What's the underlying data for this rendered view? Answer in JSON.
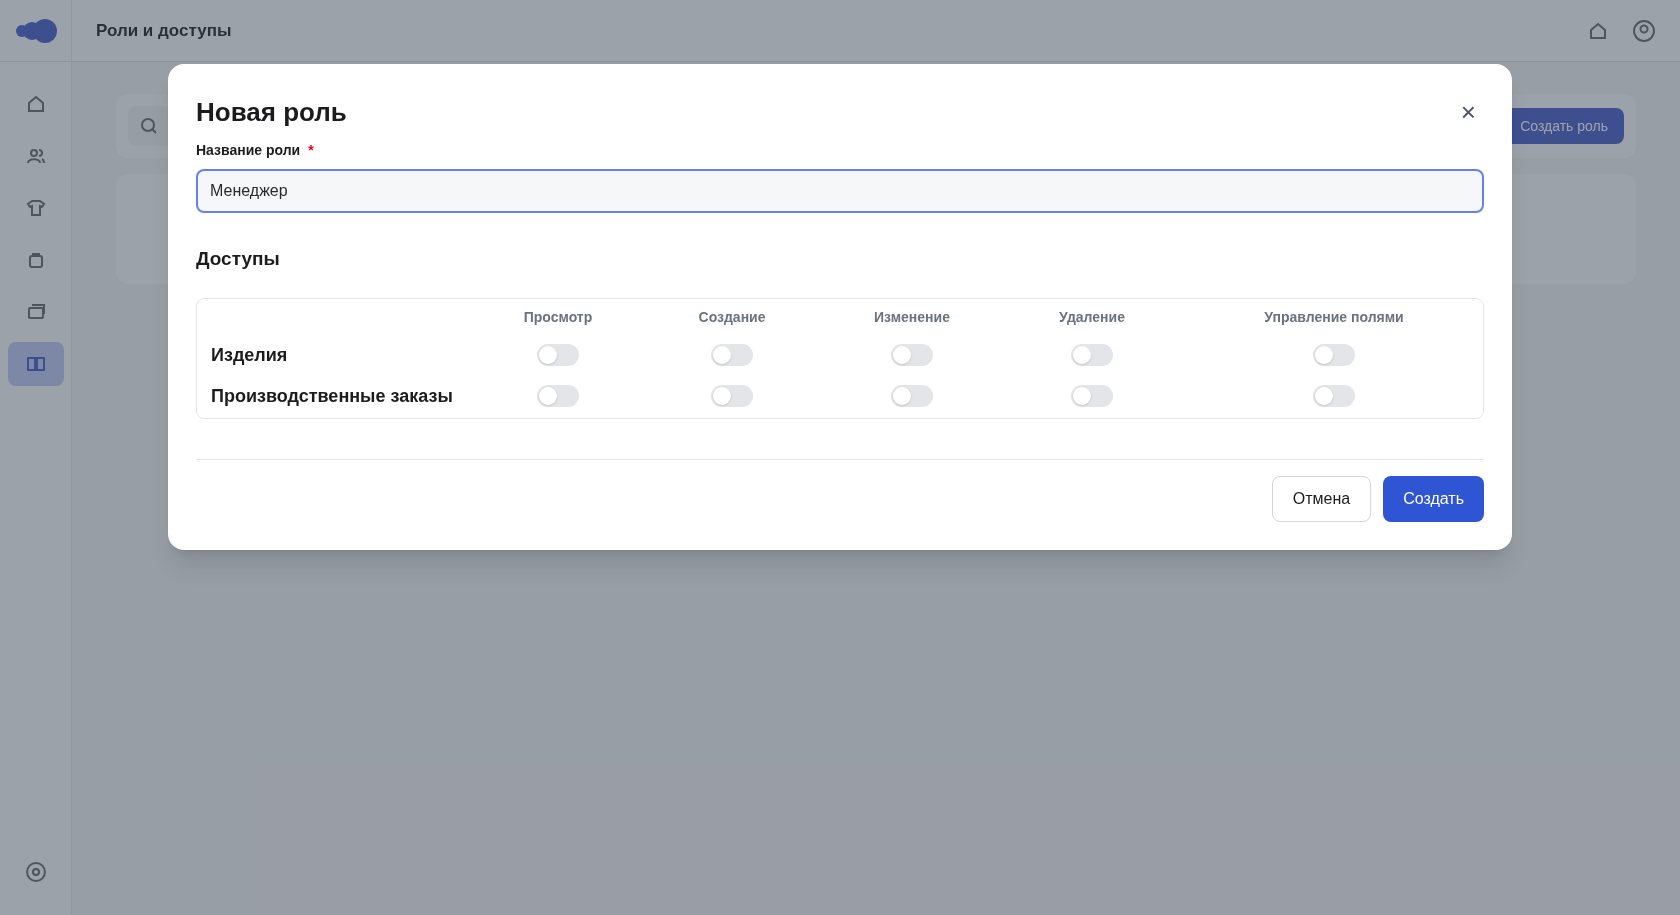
{
  "header": {
    "title": "Роли и доступы"
  },
  "sidebar": {
    "items": [
      {
        "selected": false
      },
      {
        "selected": false
      },
      {
        "selected": false
      },
      {
        "selected": false
      },
      {
        "selected": false
      },
      {
        "selected": true
      }
    ]
  },
  "toolbar": {
    "create_button": "Создать роль"
  },
  "dialog": {
    "title": "Новая роль",
    "close": "×",
    "name_field": {
      "label": "Название роли",
      "required_mark": "*",
      "value": "Менеджер"
    },
    "section_title": "Доступы",
    "permissions": {
      "columns": [
        "Просмотр",
        "Создание",
        "Изменение",
        "Удаление",
        "Управление полями"
      ],
      "rows": [
        {
          "label": "Изделия",
          "toggles": [
            {
              "on": false
            },
            {
              "on": false
            },
            {
              "on": false
            },
            {
              "on": false
            },
            {
              "on": false
            }
          ]
        },
        {
          "label": "Производственные заказы",
          "toggles": [
            {
              "on": false
            },
            {
              "on": false
            },
            {
              "on": false
            },
            {
              "on": false
            },
            {
              "on": false
            }
          ]
        }
      ]
    },
    "buttons": {
      "cancel": "Отмена",
      "submit": "Создать"
    }
  }
}
